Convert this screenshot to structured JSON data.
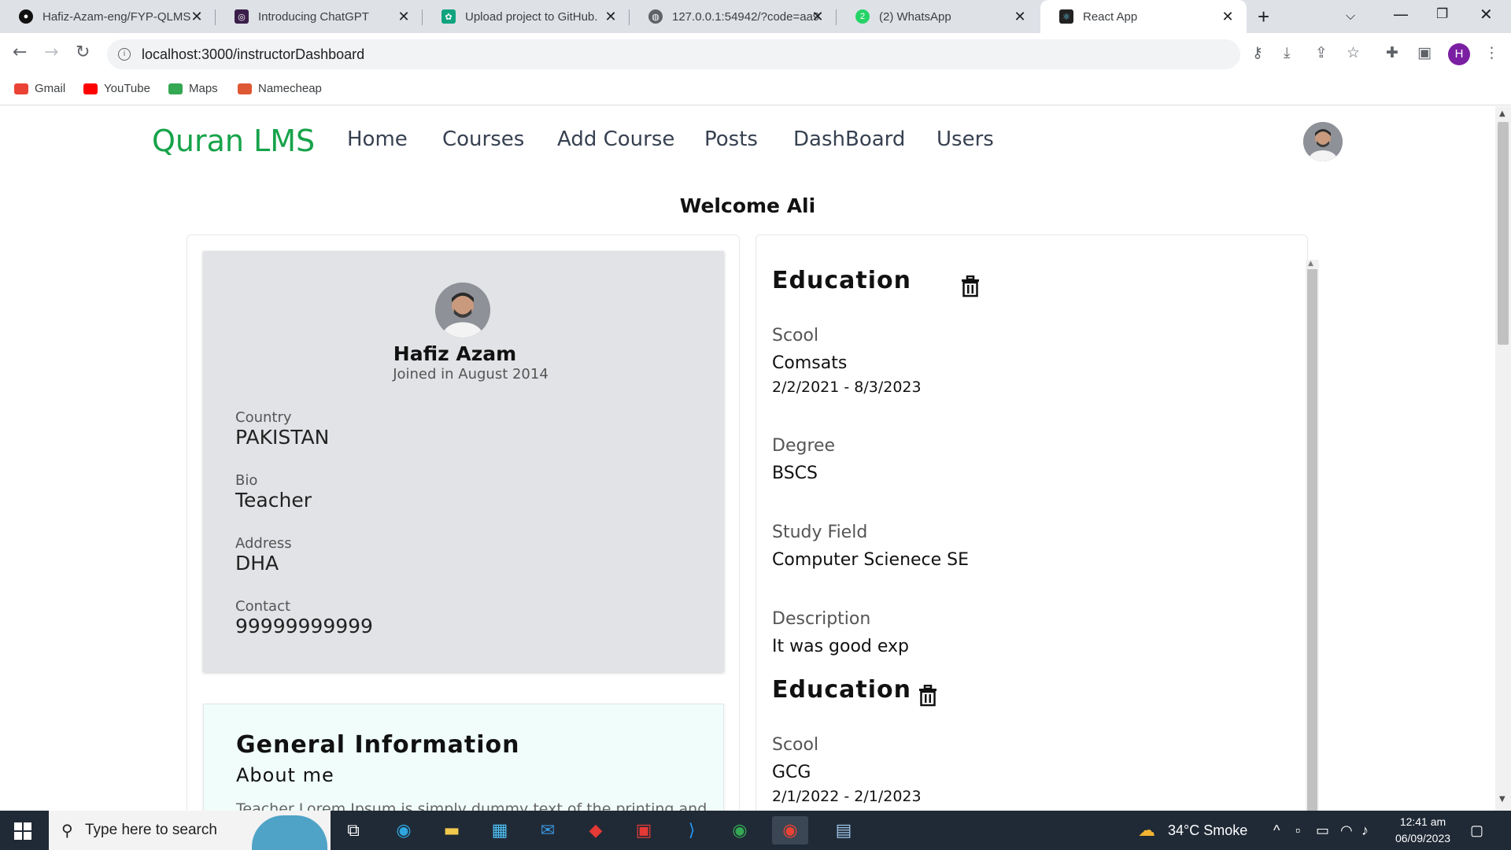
{
  "browser": {
    "tabs": [
      {
        "title": "Hafiz-Azam-eng/FYP-QLMS",
        "favicon": "github-icon",
        "color": "#111"
      },
      {
        "title": "Introducing ChatGPT",
        "favicon": "chatgpt-icon",
        "color": "#3b1f4a"
      },
      {
        "title": "Upload project to GitHub.",
        "favicon": "openai-icon",
        "color": "#10a37f"
      },
      {
        "title": "127.0.0.1:54942/?code=aa9",
        "favicon": "globe-icon",
        "color": "#5f6368"
      },
      {
        "title": "(2) WhatsApp",
        "favicon": "whatsapp-icon",
        "color": "#25d366"
      },
      {
        "title": "React App",
        "favicon": "react-icon",
        "color": "#222"
      }
    ],
    "url": "localhost:3000/instructorDashboard",
    "profile_initial": "H",
    "bookmarks": [
      {
        "label": "Gmail",
        "icon": "gmail-icon",
        "color": "#ea4335"
      },
      {
        "label": "YouTube",
        "icon": "youtube-icon",
        "color": "#ff0000"
      },
      {
        "label": "Maps",
        "icon": "maps-icon",
        "color": "#34a853"
      },
      {
        "label": "Namecheap",
        "icon": "namecheap-icon",
        "color": "#de5833"
      }
    ]
  },
  "app": {
    "brand": "Quran LMS",
    "brand_color": "#16a34a",
    "nav": [
      "Home",
      "Courses",
      "Add Course",
      "Posts",
      "DashBoard",
      "Users"
    ],
    "welcome": "Welcome Ali"
  },
  "profile": {
    "name": "Hafiz Azam",
    "joined": "Joined in August 2014",
    "fields": [
      {
        "label": "Country",
        "value": "PAKISTAN"
      },
      {
        "label": "Bio",
        "value": "Teacher"
      },
      {
        "label": "Address",
        "value": "DHA"
      },
      {
        "label": "Contact",
        "value": "99999999999"
      }
    ]
  },
  "general_info": {
    "title": "General Information",
    "subtitle": "About me",
    "text": "Teacher Lorem Ipsum is simply dummy text of the printing and"
  },
  "education": [
    {
      "title": "Education",
      "school_label": "Scool",
      "school": "Comsats",
      "dates": "2/2/2021 - 8/3/2023",
      "degree_label": "Degree",
      "degree": "BSCS",
      "field_label": "Study Field",
      "field": "Computer Scienece SE",
      "desc_label": "Description",
      "desc": "It was good exp"
    },
    {
      "title": "Education",
      "school_label": "Scool",
      "school": "GCG",
      "dates": "2/1/2022 - 2/1/2023"
    }
  ],
  "taskbar": {
    "search_placeholder": "Type here to search",
    "weather": "34°C  Smoke",
    "time": "12:41 am",
    "date": "06/09/2023"
  }
}
